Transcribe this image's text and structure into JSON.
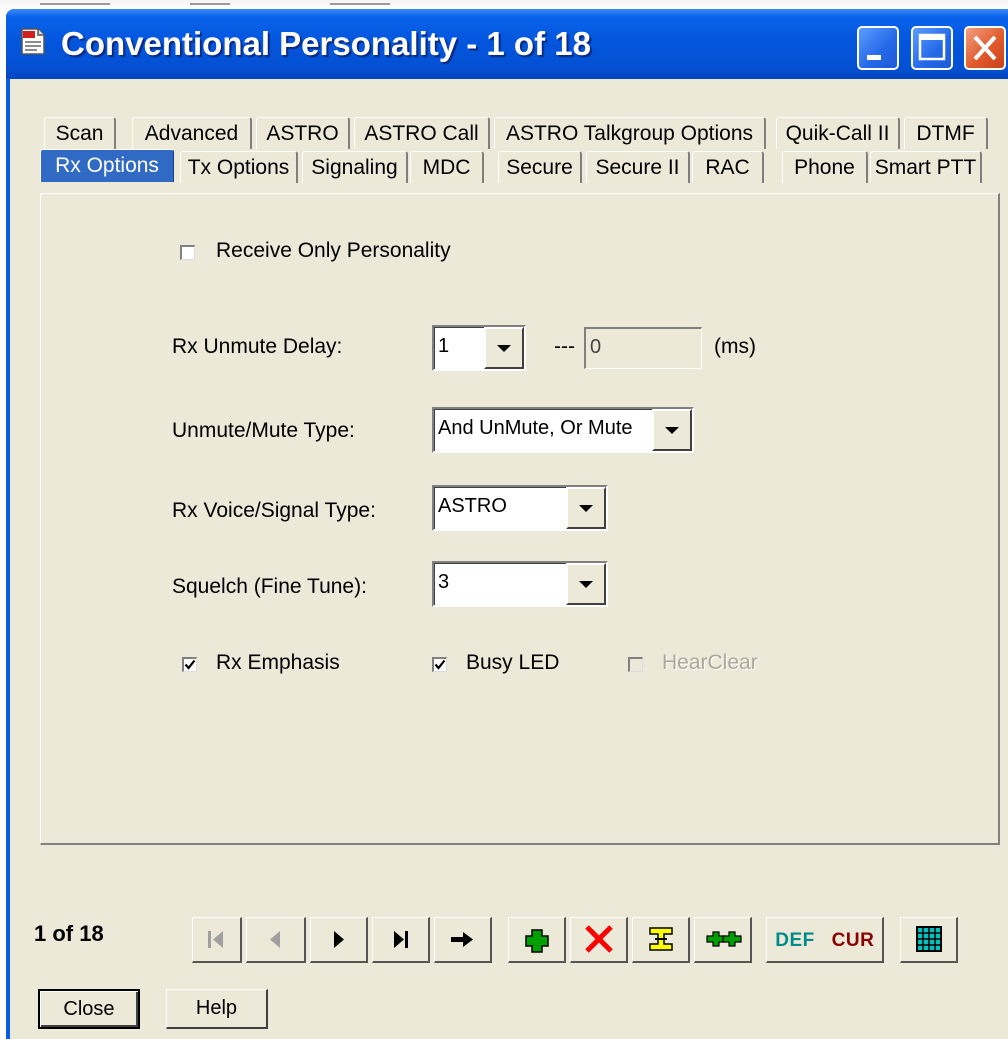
{
  "window": {
    "title": "Conventional Personality - 1 of 18"
  },
  "tabs": {
    "row1": [
      "Scan",
      "Advanced",
      "ASTRO",
      "ASTRO Call",
      "ASTRO Talkgroup Options",
      "Quik-Call II",
      "DTMF"
    ],
    "row2": [
      "Rx Options",
      "Tx Options",
      "Signaling",
      "MDC",
      "Secure",
      "Secure II",
      "RAC",
      "Phone",
      "Smart PTT"
    ],
    "active": "Rx Options"
  },
  "form": {
    "receive_only": {
      "label": "Receive Only Personality",
      "checked": false
    },
    "unmute_delay": {
      "label": "Rx Unmute Delay:",
      "value": "1",
      "separator": "---",
      "ms_value": "0",
      "unit": "(ms)"
    },
    "unmute_mute_type": {
      "label": "Unmute/Mute Type:",
      "value": "And UnMute, Or Mute"
    },
    "voice_signal_type": {
      "label": "Rx Voice/Signal Type:",
      "value": "ASTRO"
    },
    "squelch": {
      "label": "Squelch (Fine Tune):",
      "value": "3"
    },
    "rx_emphasis": {
      "label": "Rx Emphasis",
      "checked": true
    },
    "busy_led": {
      "label": "Busy LED",
      "checked": true
    },
    "hearclear": {
      "label": "HearClear",
      "checked": false,
      "enabled": false
    }
  },
  "status": {
    "position_text": "1 of 18"
  },
  "toolbar": {
    "def_label": "DEF",
    "cur_label": "CUR"
  },
  "buttons": {
    "close": "Close",
    "help": "Help"
  },
  "colors": {
    "title_bar": "#0a5ce0",
    "dialog_face": "#ece9d8",
    "active_tab": "#316ac5",
    "def_text": "#008b8b",
    "cur_text": "#8b0000",
    "add_icon": "#00a000",
    "delete_icon": "#ff0000"
  }
}
